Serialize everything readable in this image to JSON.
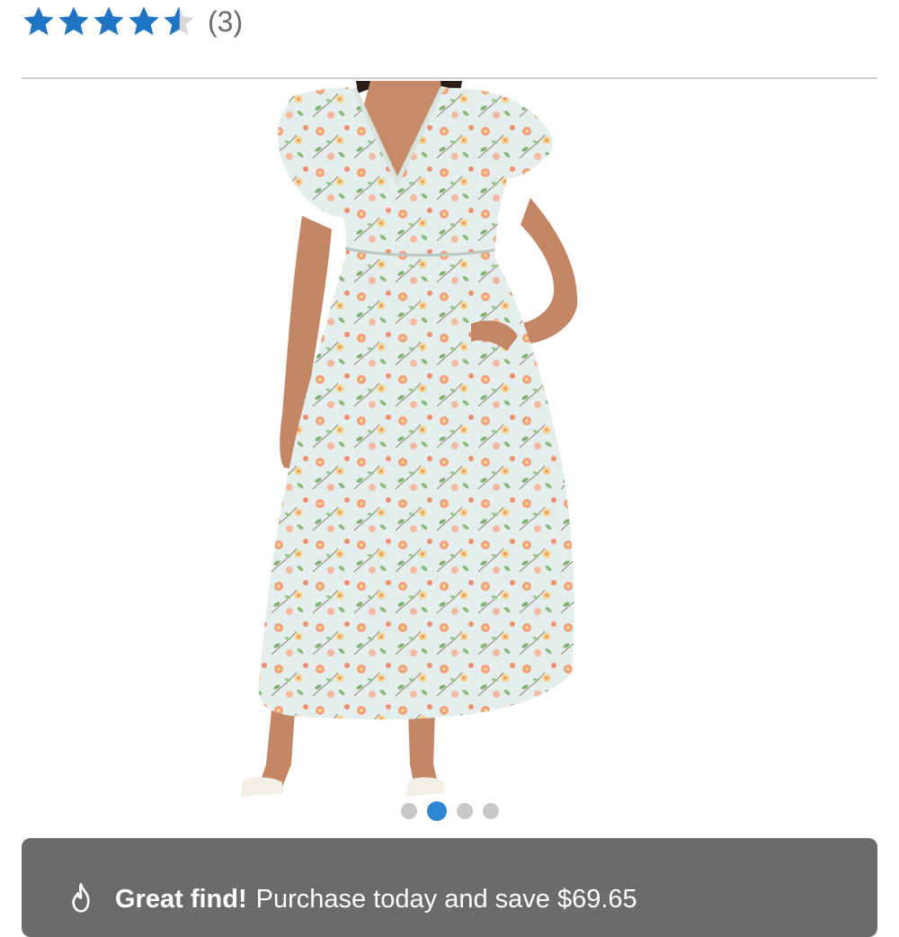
{
  "rating": {
    "value": 4.5,
    "max": 5,
    "count_label": "(3)",
    "star_color": "#1f74c4",
    "empty_star_color": "#d7d7d7"
  },
  "gallery": {
    "image_alt": "floral-midi-dress-photo",
    "active_index": 2,
    "total": 4,
    "dot_active_color": "#2f86d0",
    "dot_color": "#c8c8c8"
  },
  "banner": {
    "icon": "flame-icon",
    "bold_text": "Great find!",
    "text": "Purchase today and save $69.65",
    "background": "#6b6b6b"
  }
}
